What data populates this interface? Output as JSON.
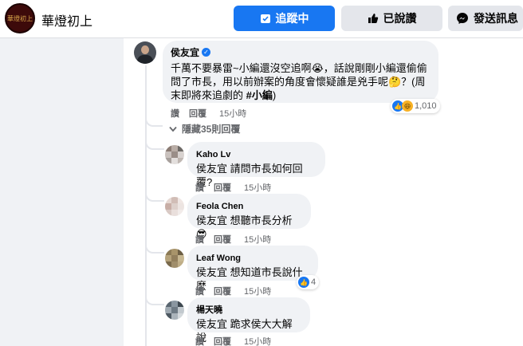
{
  "header": {
    "page_name": "華燈初上",
    "avatar_text": "華燈初上",
    "follow_label": "追蹤中",
    "like_label": "已說讚",
    "message_label": "發送訊息"
  },
  "main_comment": {
    "author": "侯友宜",
    "text": "千萬不要暴雷~小編還沒空追啊😭，話說剛剛小編還偷偷問了市長，用以前辦案的角度會懷疑誰是兇手呢🤔？(周末即將來追劇的 #小編)",
    "reaction_count": "1,010",
    "like_label": "讚",
    "reply_label": "回覆",
    "time": "15小時"
  },
  "hidden_replies_label": "隱藏35則回覆",
  "replies": [
    {
      "author": "Kaho Lv",
      "mention": "侯友宜",
      "text": "請問市長如何回覆?",
      "like_label": "讚",
      "reply_label": "回覆",
      "time": "15小時",
      "reaction_count": ""
    },
    {
      "author": "Feola Chen",
      "mention": "侯友宜",
      "text": "想聽市長分析😎",
      "like_label": "讚",
      "reply_label": "回覆",
      "time": "15小時",
      "reaction_count": ""
    },
    {
      "author": "Leaf Wong",
      "mention": "侯友宜",
      "text": "想知道市長說什麼",
      "like_label": "讚",
      "reply_label": "回覆",
      "time": "15小時",
      "reaction_count": "4"
    },
    {
      "author": "楊天曉",
      "mention": "侯友宜",
      "text": "跪求侯大大解說",
      "like_label": "讚",
      "reply_label": "回覆",
      "time": "15小時",
      "reaction_count": ""
    }
  ],
  "colors": {
    "accent": "#1877f2",
    "secondary_text": "#65676b",
    "bubble": "#f0f2f5"
  },
  "icons": [
    "check-calendar-icon",
    "thumbs-up-icon",
    "messenger-icon",
    "verified-badge-icon",
    "chevron-down-icon",
    "like-reaction-icon",
    "haha-reaction-icon"
  ]
}
